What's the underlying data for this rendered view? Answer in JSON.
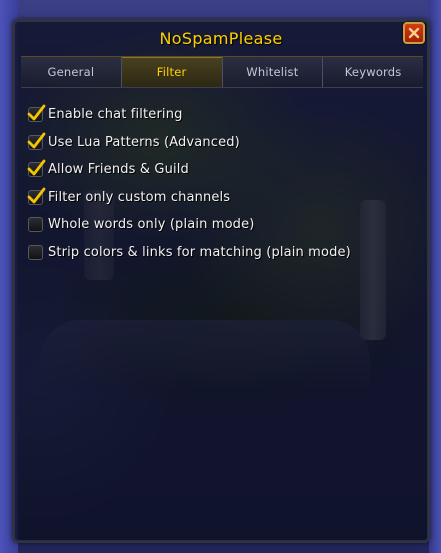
{
  "app": {
    "title": "NoSpamPlease"
  },
  "window": {
    "close_icon": "close-x-icon",
    "close_color": "#c72d0b"
  },
  "tabs": [
    {
      "label": "General",
      "active": false
    },
    {
      "label": "Filter",
      "active": true
    },
    {
      "label": "Whitelist",
      "active": false
    },
    {
      "label": "Keywords",
      "active": false
    }
  ],
  "options": [
    {
      "label": "Enable chat filtering",
      "checked": true
    },
    {
      "label": "Use Lua Patterns (Advanced)",
      "checked": true
    },
    {
      "label": "Allow Friends & Guild",
      "checked": true
    },
    {
      "label": "Filter only custom channels",
      "checked": true
    },
    {
      "label": "Whole words only (plain mode)",
      "checked": false
    },
    {
      "label": "Strip colors & links for matching (plain mode)",
      "checked": false
    }
  ],
  "colors": {
    "accent_gold": "#ffd100",
    "check_gold": "#f5c400"
  }
}
